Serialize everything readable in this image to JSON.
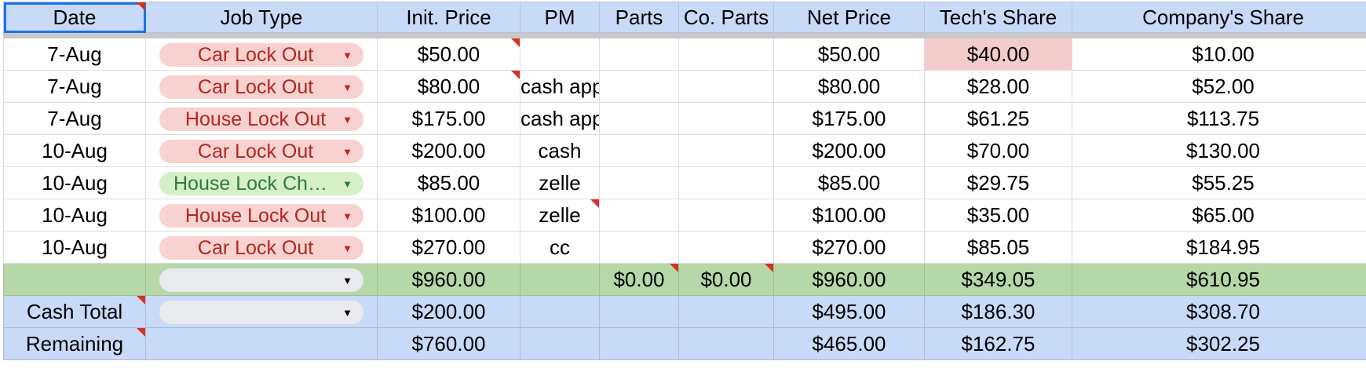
{
  "headers": [
    "Date",
    "Job Type",
    "Init. Price",
    "PM",
    "Parts",
    "Co. Parts",
    "Net Price",
    "Tech's Share",
    "Company's Share"
  ],
  "rows": [
    {
      "date": "7-Aug",
      "job_type": "Car Lock Out",
      "chip": "red",
      "init_price": "$50.00",
      "pm": "",
      "parts": "",
      "co_parts": "",
      "net_price": "$50.00",
      "tech_share": "$40.00",
      "company_share": "$10.00"
    },
    {
      "date": "7-Aug",
      "job_type": "Car Lock Out",
      "chip": "red",
      "init_price": "$80.00",
      "pm": "cash app",
      "parts": "",
      "co_parts": "",
      "net_price": "$80.00",
      "tech_share": "$28.00",
      "company_share": "$52.00"
    },
    {
      "date": "7-Aug",
      "job_type": "House Lock Out",
      "chip": "red",
      "init_price": "$175.00",
      "pm": "cash app",
      "parts": "",
      "co_parts": "",
      "net_price": "$175.00",
      "tech_share": "$61.25",
      "company_share": "$113.75"
    },
    {
      "date": "10-Aug",
      "job_type": "Car Lock Out",
      "chip": "red",
      "init_price": "$200.00",
      "pm": "cash",
      "parts": "",
      "co_parts": "",
      "net_price": "$200.00",
      "tech_share": "$70.00",
      "company_share": "$130.00"
    },
    {
      "date": "10-Aug",
      "job_type": "House Lock Cha…",
      "chip": "green",
      "init_price": "$85.00",
      "pm": "zelle",
      "parts": "",
      "co_parts": "",
      "net_price": "$85.00",
      "tech_share": "$29.75",
      "company_share": "$55.25"
    },
    {
      "date": "10-Aug",
      "job_type": "House Lock Out",
      "chip": "red",
      "init_price": "$100.00",
      "pm": "zelle",
      "parts": "",
      "co_parts": "",
      "net_price": "$100.00",
      "tech_share": "$35.00",
      "company_share": "$65.00"
    },
    {
      "date": "10-Aug",
      "job_type": "Car Lock Out",
      "chip": "red",
      "init_price": "$270.00",
      "pm": "cc",
      "parts": "",
      "co_parts": "",
      "net_price": "$270.00",
      "tech_share": "$85.05",
      "company_share": "$184.95"
    }
  ],
  "total": {
    "init_price": "$960.00",
    "parts": "$0.00",
    "co_parts": "$0.00",
    "net_price": "$960.00",
    "tech_share": "$349.05",
    "company_share": "$610.95"
  },
  "cash_total": {
    "label": "Cash Total",
    "init_price": "$200.00",
    "net_price": "$495.00",
    "tech_share": "$186.30",
    "company_share": "$308.70"
  },
  "remaining": {
    "label": "Remaining",
    "init_price": "$760.00",
    "net_price": "$465.00",
    "tech_share": "$162.75",
    "company_share": "$302.25"
  },
  "colors": {
    "header_bg": "#c9daf8",
    "total_bg": "#b6d7a8",
    "highlight_bg": "#f4cccc",
    "negative_text": "#c5221f",
    "chip_red": "#f7d2d0",
    "chip_green": "#d6efc9",
    "chip_grey": "#e8eaed"
  },
  "icons": {
    "dropdown": "triangle-down-icon",
    "comment": "comment-indicator"
  }
}
